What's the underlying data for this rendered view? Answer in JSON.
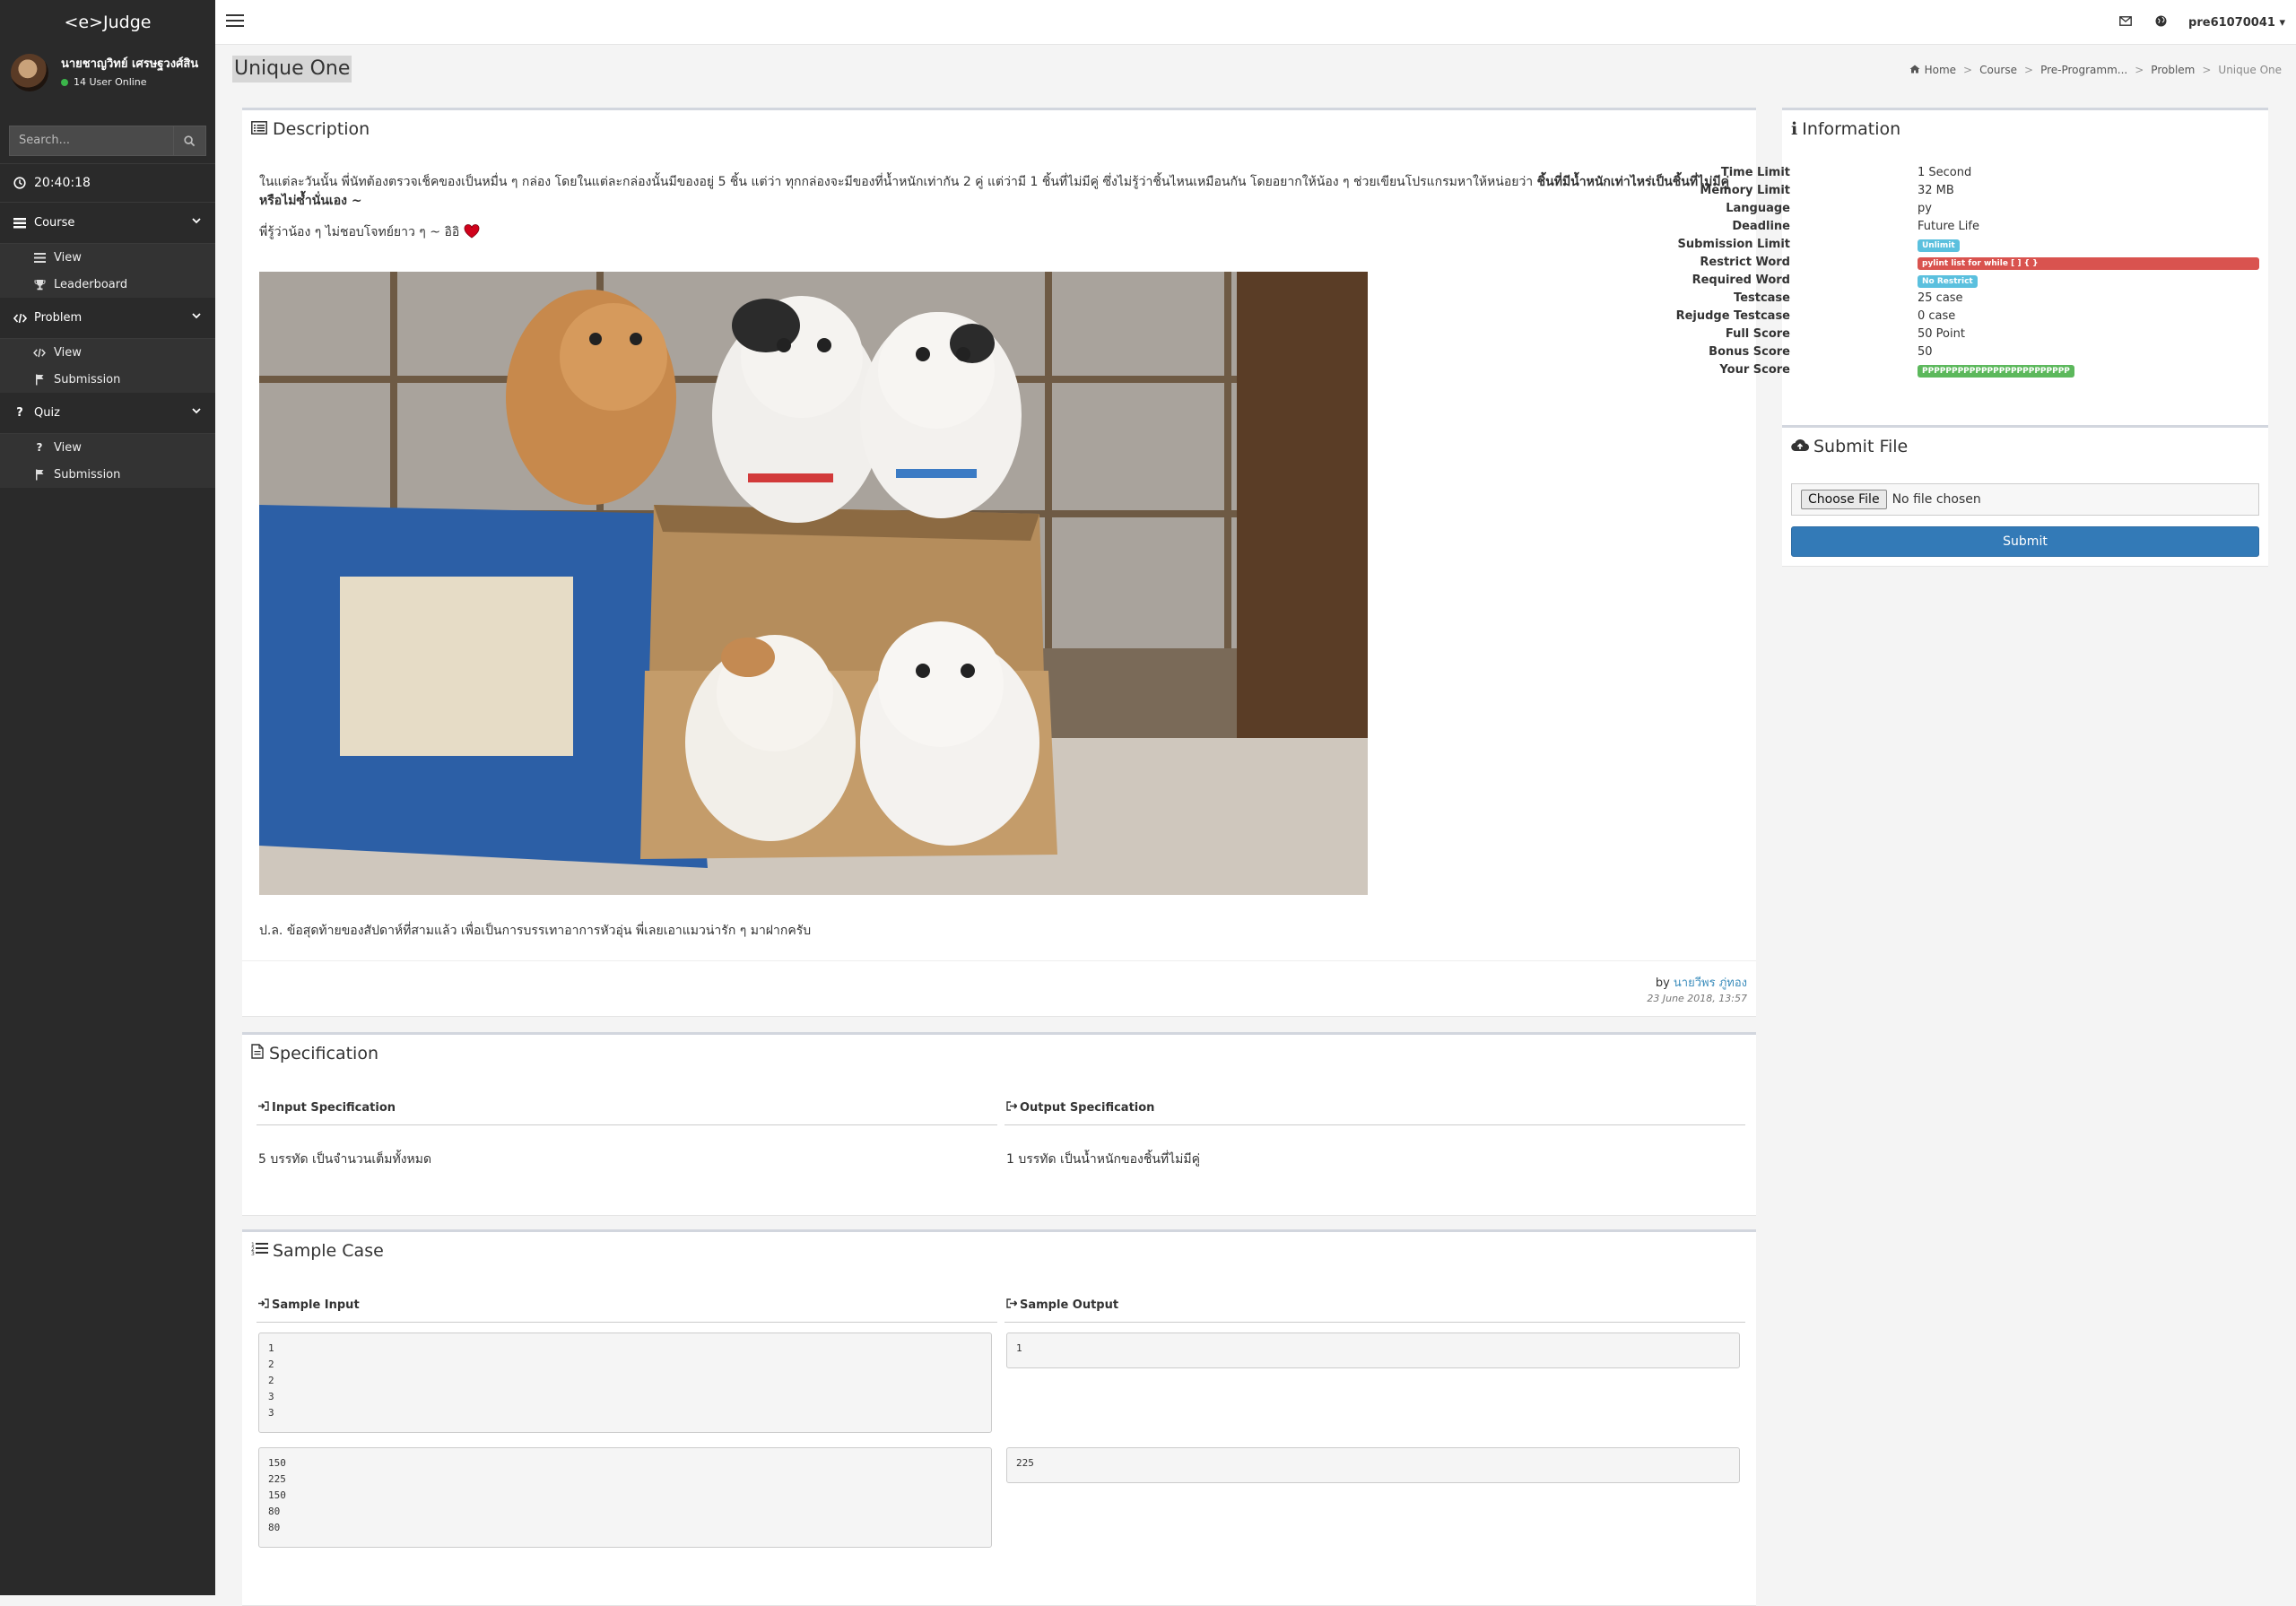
{
  "app": {
    "brand": "<e>Judge"
  },
  "user": {
    "name": "นายชาญวิทย์ เศรษฐวงศ์สิน",
    "online_text": "14 User Online",
    "username": "pre61070041"
  },
  "sidebar": {
    "search_placeholder": "Search...",
    "clock": "20:40:18",
    "sections": [
      {
        "label": "Course",
        "items": [
          "View",
          "Leaderboard"
        ]
      },
      {
        "label": "Problem",
        "items": [
          "View",
          "Submission"
        ]
      },
      {
        "label": "Quiz",
        "items": [
          "View",
          "Submission"
        ]
      }
    ]
  },
  "page": {
    "title": "Unique One"
  },
  "breadcrumb": [
    "Home",
    "Course",
    "Pre-Programm...",
    "Problem",
    "Unique One"
  ],
  "description": {
    "title": "Description",
    "para1": "ในแต่ละวันนั้น พี่นัทต้องตรวจเช็คของเป็นหมื่น ๆ กล่อง โดยในแต่ละกล่องนั้นมีของอยู่ 5 ชิ้น แต่ว่า ทุกกล่องจะมีของที่น้ำหนักเท่ากัน 2 คู่ แต่ว่ามี 1 ชิ้นที่ไม่มีคู่ ซึ่งไม่รู้ว่าชิ้นไหนเหมือนกัน โดยอยากให้น้อง ๆ ช่วยเขียนโปรแกรมหาให้หน่อยว่า",
    "para1_bold": "ชิ้นที่มีน้ำหนักเท่าไหร่เป็นชิ้นที่ไม่มีคู่ หรือไม่ซ้ำนั่นเอง ~",
    "para2": "พี่รู้ว่าน้อง ๆ ไม่ชอบโจทย์ยาว ๆ ~ อิอิ",
    "ps": "ป.ล. ข้อสุดท้ายของสัปดาห์ที่สามแล้ว เพื่อเป็นการบรรเทาอาการหัวอุ่น พี่เลยเอาแมวน่ารัก ๆ มาฝากครับ",
    "by_label": "by",
    "author": "นายวีพร ภู่ทอง",
    "date": "23 June 2018, 13:57"
  },
  "specification": {
    "title": "Specification",
    "input_label": "Input Specification",
    "output_label": "Output Specification",
    "input_text": "5 บรรทัด เป็นจำนวนเต็มทั้งหมด",
    "output_text": "1 บรรทัด เป็นน้ำหนักของชิ้นที่ไม่มีคู่"
  },
  "sample": {
    "title": "Sample Case",
    "input_label": "Sample Input",
    "output_label": "Sample Output",
    "cases": [
      {
        "input": "1\n2\n2\n3\n3",
        "output": "1"
      },
      {
        "input": "150\n225\n150\n80\n80",
        "output": "225"
      }
    ]
  },
  "information": {
    "title": "Information",
    "rows": [
      {
        "label": "Time Limit",
        "value": "1 Second"
      },
      {
        "label": "Memory Limit",
        "value": "32 MB"
      },
      {
        "label": "Language",
        "value": "py"
      },
      {
        "label": "Deadline",
        "value": "Future Life"
      },
      {
        "label": "Submission Limit",
        "badge": "Unlimit",
        "color": "#5bc0de"
      },
      {
        "label": "Restrict Word",
        "badge": "pylint list for while [ ] { }",
        "color": "#d9534f"
      },
      {
        "label": "Required Word",
        "badge": "No Restrict",
        "color": "#5bc0de"
      },
      {
        "label": "Testcase",
        "value": "25 case"
      },
      {
        "label": "Rejudge Testcase",
        "value": "0 case"
      },
      {
        "label": "Full Score",
        "value": "50 Point"
      },
      {
        "label": "Bonus Score",
        "value": "50"
      },
      {
        "label": "Your Score",
        "badge": "PPPPPPPPPPPPPPPPPPPPPPPPP",
        "color": "#5cb85c"
      }
    ]
  },
  "submit": {
    "title": "Submit File",
    "choose_label": "Choose File",
    "no_file": "No file chosen",
    "button": "Submit"
  }
}
